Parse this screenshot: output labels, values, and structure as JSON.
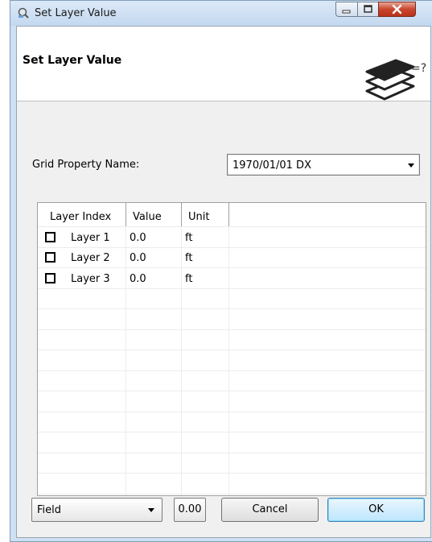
{
  "window": {
    "title": "Set Layer Value",
    "controls": [
      "minimize-icon",
      "maximize-icon",
      "close-icon"
    ]
  },
  "header": {
    "title": "Set Layer Value",
    "icon": "layers-query-icon",
    "icon_text": "=?"
  },
  "grid_property": {
    "label": "Grid Property Name:",
    "selected": "1970/01/01 DX"
  },
  "table": {
    "columns": [
      "Layer Index",
      "Value",
      "Unit"
    ],
    "rows": [
      {
        "name": "Layer 1",
        "value": "0.0",
        "unit": "ft",
        "checked": false
      },
      {
        "name": "Layer 2",
        "value": "0.0",
        "unit": "ft",
        "checked": false
      },
      {
        "name": "Layer 3",
        "value": "0.0",
        "unit": "ft",
        "checked": false
      }
    ]
  },
  "footer": {
    "field_selected": "Field",
    "value": "0.00",
    "cancel_label": "Cancel",
    "ok_label": "OK"
  },
  "colors": {
    "titlebar": "#c3d8f0",
    "close_button": "#c9462c",
    "ok_border": "#3c7fb1"
  }
}
